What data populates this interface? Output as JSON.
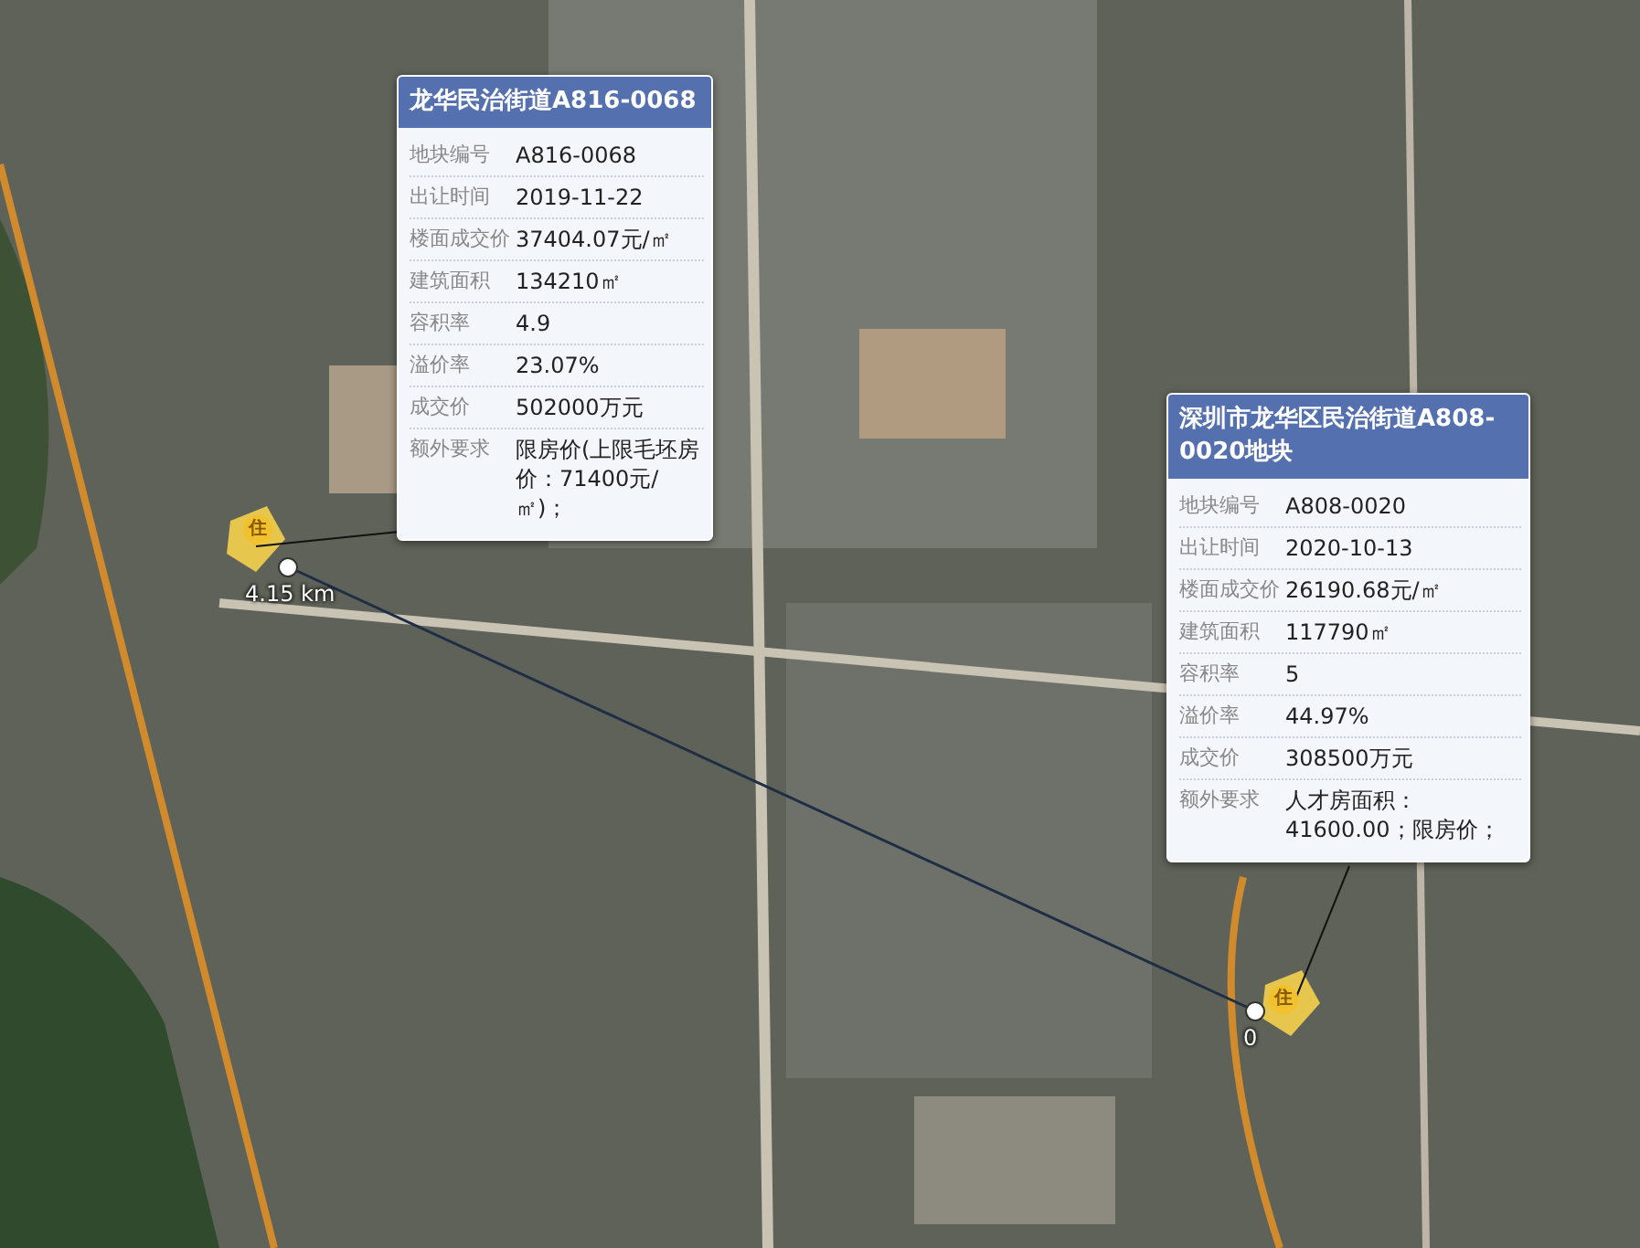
{
  "parcels": [
    {
      "marker": "住",
      "distance": "4.15 km",
      "title": "龙华民治街道A816-0068",
      "fields": [
        {
          "label": "地块编号",
          "value": "A816-0068"
        },
        {
          "label": "出让时间",
          "value": "2019-11-22"
        },
        {
          "label": "楼面成交价",
          "value": "37404.07元/㎡"
        },
        {
          "label": "建筑面积",
          "value": "134210㎡"
        },
        {
          "label": "容积率",
          "value": "4.9"
        },
        {
          "label": "溢价率",
          "value": "23.07%"
        },
        {
          "label": "成交价",
          "value": "502000万元"
        },
        {
          "label": "额外要求",
          "value": "限房价(上限毛坯房价：71400元/㎡)；"
        }
      ]
    },
    {
      "marker": "住",
      "distance": "0",
      "title": "深圳市龙华区民治街道A808-0020地块",
      "fields": [
        {
          "label": "地块编号",
          "value": "A808-0020"
        },
        {
          "label": "出让时间",
          "value": "2020-10-13"
        },
        {
          "label": "楼面成交价",
          "value": "26190.68元/㎡"
        },
        {
          "label": "建筑面积",
          "value": "117790㎡"
        },
        {
          "label": "容积率",
          "value": "5"
        },
        {
          "label": "溢价率",
          "value": "44.97%"
        },
        {
          "label": "成交价",
          "value": "308500万元"
        },
        {
          "label": "额外要求",
          "value": "人才房面积：41600.00；限房价；"
        }
      ]
    }
  ]
}
